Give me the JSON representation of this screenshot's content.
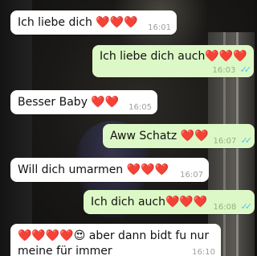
{
  "messages": [
    {
      "direction": "incoming",
      "text": "Ich liebe dich ❤️❤️❤️",
      "time": "16:01",
      "status": ""
    },
    {
      "direction": "outgoing",
      "text": "Ich liebe dich auch❤️❤️❤️",
      "time": "16:03",
      "status": "read"
    },
    {
      "direction": "incoming",
      "text": "Besser Baby ❤️❤️",
      "time": "16:05",
      "status": ""
    },
    {
      "direction": "outgoing",
      "text": "Aww Schatz ❤️❤️",
      "time": "16:07",
      "status": "read"
    },
    {
      "direction": "incoming",
      "text": "Will dich umarmen ❤️❤️❤️",
      "time": "16:07",
      "status": ""
    },
    {
      "direction": "outgoing",
      "text": "Ich dich auch❤️❤️❤️",
      "time": "16:08",
      "status": "read"
    },
    {
      "direction": "incoming",
      "text": "❤️❤️❤️❤️😍 aber dann bidt fu nur meine für immer",
      "time": "16:10",
      "status": ""
    }
  ],
  "read_ticks": "✓✓",
  "colors": {
    "incoming_bubble": "#ffffff",
    "outgoing_bubble": "#dcf8c6",
    "read_tick": "#4fc3f7",
    "heart": "#d0021b"
  }
}
